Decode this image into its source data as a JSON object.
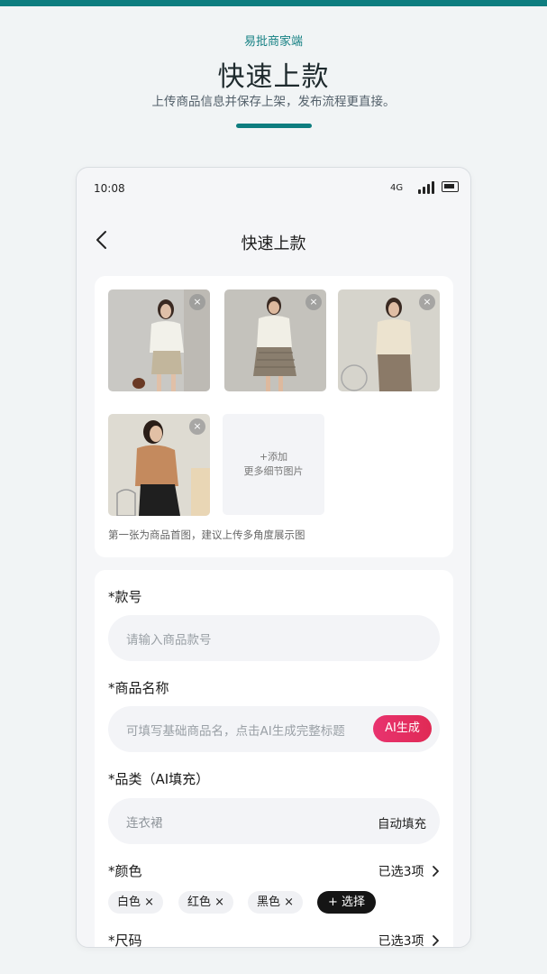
{
  "brand": "易批商家端",
  "hero_title": "快速上款",
  "hero_subtitle": "上传商品信息并保存上架，发布流程更直接。",
  "colors": {
    "accent": "#0e7d7f",
    "ai_button": "#e8336f",
    "chip_dark": "#151515"
  },
  "status_bar": {
    "time": "10:08",
    "network": "4G",
    "signal_icon": "signal-bars-icon",
    "battery_icon": "battery-icon"
  },
  "nav": {
    "title": "快速上款",
    "back_icon": "chevron-left-icon"
  },
  "images": {
    "add_line1": "+添加",
    "add_line2": "更多细节图片",
    "hint": "第一张为商品首图，建议上传多角度展示图",
    "delete_symbol": "×"
  },
  "form": {
    "style_no": {
      "label": "*款号",
      "placeholder": "请输入商品款号"
    },
    "product_name": {
      "label": "*商品名称",
      "placeholder": "可填写基础商品名，点击AI生成完整标题",
      "ai_button": "AI生成"
    },
    "category": {
      "label": "*品类（AI填充）",
      "value": "连衣裙",
      "auto": "自动填充"
    },
    "color": {
      "label": "*颜色",
      "selected": "已选3项",
      "chips": [
        "白色 ×",
        "红色 ×",
        "黑色 ×"
      ],
      "add_button": "+ 选择"
    },
    "size": {
      "label": "*尺码",
      "selected": "已选3项"
    }
  }
}
